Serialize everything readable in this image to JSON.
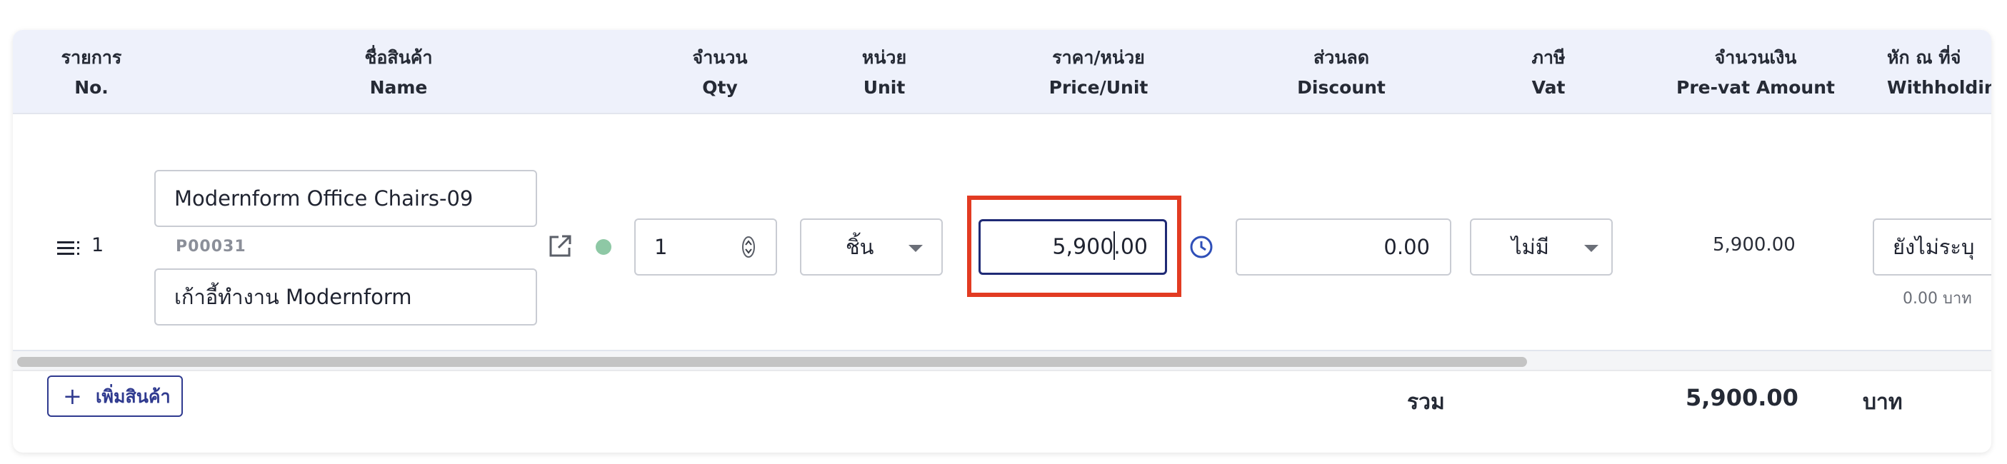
{
  "columns": {
    "no": {
      "th": "รายการ",
      "en": "No."
    },
    "name": {
      "th": "ชื่อสินค้า",
      "en": "Name"
    },
    "qty": {
      "th": "จำนวน",
      "en": "Qty"
    },
    "unit": {
      "th": "หน่วย",
      "en": "Unit"
    },
    "price": {
      "th": "ราคา/หน่วย",
      "en": "Price/Unit"
    },
    "discount": {
      "th": "ส่วนลด",
      "en": "Discount"
    },
    "vat": {
      "th": "ภาษี",
      "en": "Vat"
    },
    "amount": {
      "th": "จำนวนเงิน",
      "en": "Pre-vat Amount"
    },
    "withholding": {
      "th": "หัก ณ ที่จ่",
      "en": "Withholdin"
    }
  },
  "row": {
    "no": "1",
    "product_name": "Modernform Office Chairs-09",
    "sku": "P00031",
    "description": "เก้าอี้ทำงาน Modernform",
    "qty": "1",
    "unit": "ชิ้น",
    "price": "5,900.00",
    "discount": "0.00",
    "vat": "ไม่มี",
    "amount": "5,900.00",
    "withholding": "ยังไม่ระบุ",
    "withholding_amount": "0.00 บาท"
  },
  "footer": {
    "add_label": "เพิ่มสินค้า",
    "total_label": "รวม",
    "total_value": "5,900.00",
    "total_unit": "บาท"
  },
  "icons": {
    "drag": "drag-handle-icon",
    "open": "external-link-icon",
    "status": "status-dot-icon",
    "history": "clock-icon"
  },
  "colors": {
    "header_bg": "#eef1fb",
    "accent": "#2f3a8f",
    "highlight": "#e23b22",
    "status_dot": "#8ec8a5"
  }
}
